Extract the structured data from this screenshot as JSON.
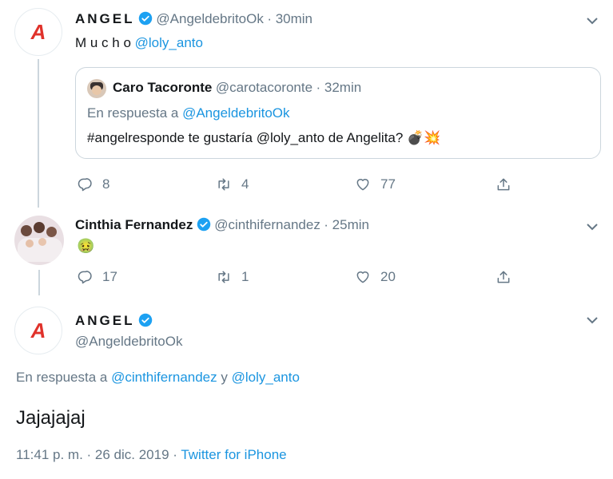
{
  "tweet1": {
    "avatar_letter": "A",
    "name": "ANGEL",
    "handle": "@AngeldebritoOk",
    "time": "· 30min",
    "text_prefix": "M u c h o ",
    "text_mention": "@loly_anto",
    "quote": {
      "name": "Caro Tacoronte",
      "handle": "@carotacoronte",
      "time": "· 32min",
      "reply_prefix": "En respuesta a ",
      "reply_mention": "@AngeldebritoOk",
      "text": "#angelresponde te gustaría @loly_anto de Angelita? 💣💥"
    },
    "actions": {
      "replies": "8",
      "retweets": "4",
      "likes": "77"
    }
  },
  "tweet2": {
    "name": "Cinthia Fernandez",
    "handle": "@cinthifernandez",
    "time": "· 25min",
    "emoji": "🤢",
    "actions": {
      "replies": "17",
      "retweets": "1",
      "likes": "20"
    }
  },
  "tweet3": {
    "avatar_letter": "A",
    "name": "ANGEL",
    "handle": "@AngeldebritoOk",
    "reply_prefix": "En respuesta a ",
    "reply_mention1": "@cinthifernandez",
    "reply_and": " y ",
    "reply_mention2": "@loly_anto",
    "text": "Jajajajaj",
    "timestamp": "11:41 p. m. · 26 dic. 2019 · ",
    "source": "Twitter for iPhone"
  },
  "colors": {
    "link": "#1b95e0",
    "muted": "#657786",
    "verified": "#1da1f2"
  }
}
